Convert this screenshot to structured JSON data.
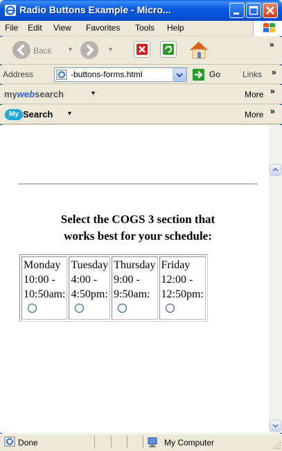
{
  "window": {
    "title": "Radio Buttons Example - Micro...",
    "min_icon": "minimize-icon",
    "max_icon": "maximize-icon",
    "close_icon": "close-icon"
  },
  "menu": {
    "items": [
      "File",
      "Edit",
      "View",
      "Favorites",
      "Tools",
      "Help"
    ]
  },
  "toolbar": {
    "back_label": "Back",
    "chevron": "»"
  },
  "address": {
    "label": "Address",
    "value": "-buttons-forms.html",
    "go_label": "Go",
    "links_label": "Links",
    "chevron": "»"
  },
  "mywebsearch": {
    "my": "my",
    "web": "web",
    "search": "search",
    "dropdown": "▾",
    "more": "More",
    "chevron": "»"
  },
  "mysearch": {
    "badge": "My",
    "label": "Search",
    "dropdown": "▾",
    "more": "More",
    "chevron": "»"
  },
  "page": {
    "heading_line1": "Select the COGS 3 section that",
    "heading_line2": "works best for your schedule:",
    "sections": [
      {
        "day": "Monday",
        "time_start": "10:00 -",
        "time_end": "10:50am:",
        "selected": false
      },
      {
        "day": "Tuesday",
        "time_start": "4:00 -",
        "time_end": "4:50pm:",
        "selected": false
      },
      {
        "day": "Thursday",
        "time_start": "9:00 -",
        "time_end": "9:50am:",
        "selected": false
      },
      {
        "day": "Friday",
        "time_start": "12:00 -",
        "time_end": "12:50pm:",
        "selected": false
      }
    ]
  },
  "status": {
    "text": "Done",
    "zone": "My Computer"
  },
  "colors": {
    "titlebar": "#0a5ae0",
    "chrome": "#ece9d8",
    "radio_border": "#1c5180"
  }
}
